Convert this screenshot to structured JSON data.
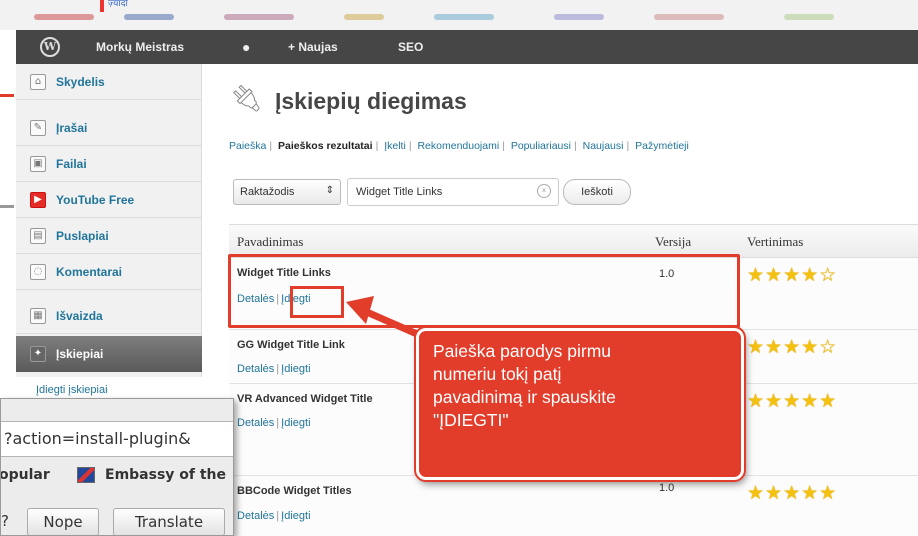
{
  "top_strip": {
    "tiny_link": "ज़्यादा"
  },
  "adminbar": {
    "wp_logo": "W",
    "site_name": "Morkų Meistras",
    "comments_icon": "speech-bubble-icon",
    "new_label": "+ Naujas",
    "seo_label": "SEO"
  },
  "sidebar": {
    "items": [
      {
        "label": "Skydelis",
        "icon": "dashboard-icon"
      },
      {
        "label": "Įrašai",
        "icon": "pin-icon"
      },
      {
        "label": "Failai",
        "icon": "media-icon"
      },
      {
        "label": "YouTube Free",
        "icon": "youtube-icon"
      },
      {
        "label": "Puslapiai",
        "icon": "pages-icon"
      },
      {
        "label": "Komentarai",
        "icon": "comments-icon"
      },
      {
        "label": "Išvaizda",
        "icon": "appearance-icon"
      },
      {
        "label": "Įskiepiai",
        "icon": "plugins-icon"
      }
    ],
    "submenu_label": "Įdiegti įskiepiai"
  },
  "main": {
    "title": "Įskiepių diegimas",
    "subnav": [
      "Paieška",
      "Paieškos rezultatai",
      "Įkelti",
      "Rekomenduojami",
      "Populiariausi",
      "Naujausi",
      "Pažymėtieji"
    ],
    "search": {
      "select_value": "Raktažodis",
      "input_value": "Widget Title Links",
      "button_label": "Ieškoti"
    },
    "table": {
      "headers": {
        "name": "Pavadinimas",
        "version": "Versija",
        "rating": "Vertinimas"
      },
      "rows": [
        {
          "name": "Widget Title Links",
          "details": "Detalės",
          "install": "Įdiegti",
          "version": "1.0",
          "stars": "★★★★☆"
        },
        {
          "name": "GG Widget Title Link",
          "details": "Detalės",
          "install": "Įdiegti",
          "version": "",
          "stars": "★★★★☆"
        },
        {
          "name": "VR Advanced Widget Title",
          "details": "Detalės",
          "install": "Įdiegti",
          "version": "",
          "stars": "★★★★★"
        },
        {
          "name": "BBCode Widget Titles",
          "details": "Detalės",
          "install": "Įdiegti",
          "version": "1.0",
          "stars": "★★★★★"
        }
      ]
    }
  },
  "callout": {
    "text": "Paieška parodys pirmu\nnumeriu tokį patį\npavadinimą ir spauskite\n\"ĮDIEGTI\""
  },
  "browser": {
    "url_fragment": "?action=install-plugin&",
    "bookmark_1": "opular",
    "bookmark_2": "Embassy of the",
    "translate_question": "?",
    "nope_label": "Nope",
    "translate_label": "Translate"
  },
  "colors": {
    "annotation_red": "#e23c2a",
    "wp_link_blue": "#21759b",
    "admin_bar": "#464646",
    "star_gold": "#f4c10f"
  }
}
